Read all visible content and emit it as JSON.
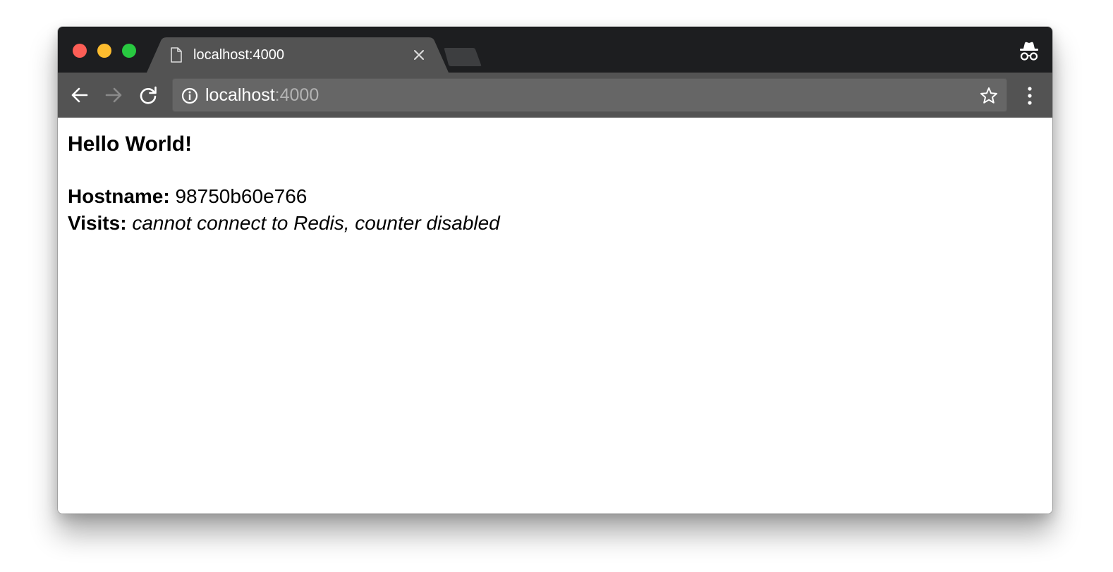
{
  "browser": {
    "tab": {
      "title": "localhost:4000"
    },
    "address_bar": {
      "host": "localhost",
      "port": ":4000"
    },
    "icons": {
      "tab": "document-icon",
      "close": "close-icon",
      "back": "arrow-left-icon",
      "forward": "arrow-right-icon",
      "reload": "reload-icon",
      "info": "info-icon",
      "bookmark": "star-icon",
      "menu": "kebab-menu-icon",
      "incognito": "incognito-icon"
    },
    "colors": {
      "frame": "#1d1e20",
      "toolbar": "#535353",
      "omnibox": "#666666",
      "close_button": "#fd5e56",
      "minimize_button": "#fdbc2e",
      "maximize_button": "#28c940"
    }
  },
  "page": {
    "heading": "Hello World!",
    "hostname": {
      "label": "Hostname:",
      "value": "98750b60e766"
    },
    "visits": {
      "label": "Visits:",
      "value": "cannot connect to Redis, counter disabled"
    }
  }
}
